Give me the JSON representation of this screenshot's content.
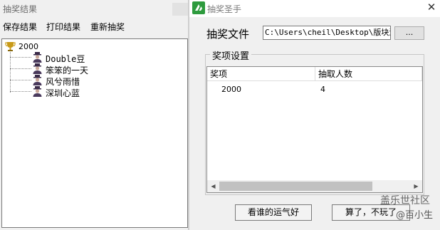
{
  "left_window": {
    "title": "抽奖结果",
    "menu": [
      "保存结果",
      "打印结果",
      "重新抽奖"
    ],
    "tree": {
      "root": "2000",
      "winners": [
        "Double豆",
        "笨笨的一天",
        "风兮雨惜",
        "深圳心蓝"
      ]
    }
  },
  "right_window": {
    "title": "抽奖圣手",
    "file_label": "抽奖文件",
    "file_path": "C:\\Users\\cheil\\Desktop\\版块活",
    "browse_label": "...",
    "group_label": "奖项设置",
    "columns": [
      "奖项",
      "抽取人数"
    ],
    "rows": [
      {
        "prize": "2000",
        "count": "4"
      }
    ],
    "btn_lucky": "看谁的运气好",
    "btn_quit": "算了，不玩了"
  },
  "watermark": {
    "line1": "盖乐世社区",
    "line2": "@百小生"
  },
  "icons": {
    "trophy": "trophy-icon",
    "winner": "person-icon",
    "app": "app-icon",
    "close": "close-icon"
  },
  "colors": {
    "window_bg": "#f0f0f0",
    "app_icon": "#2e9b3e",
    "trophy": "#c89a18",
    "person": "#4a3a5c"
  }
}
